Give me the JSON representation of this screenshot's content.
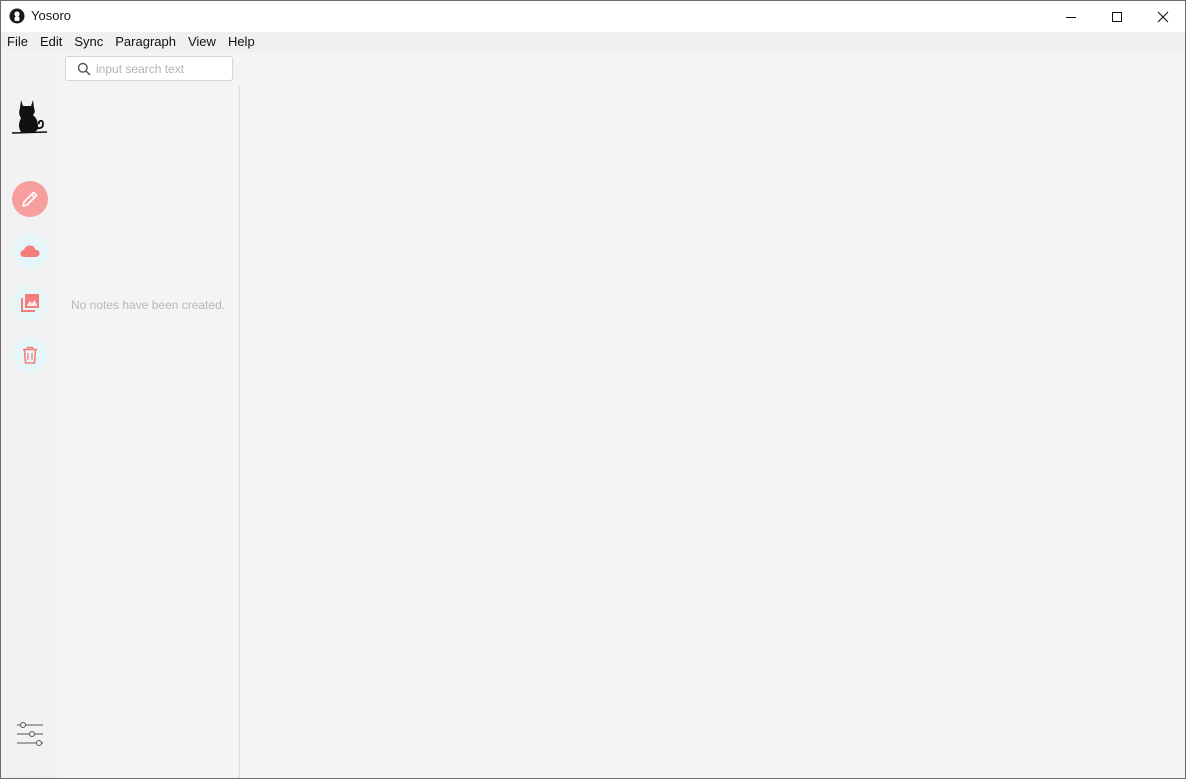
{
  "window": {
    "title": "Yosoro",
    "controls": [
      "minimize-icon",
      "maximize-icon",
      "close-icon"
    ]
  },
  "menu": {
    "items": [
      "File",
      "Edit",
      "Sync",
      "Paragraph",
      "View",
      "Help"
    ]
  },
  "search": {
    "placeholder": "input search text",
    "value": ""
  },
  "notes_list": {
    "empty_message": "No notes have been created."
  },
  "sidebar": {
    "buttons": [
      {
        "icon": "pencil-icon",
        "active": true
      },
      {
        "icon": "cloud-icon",
        "active": false
      },
      {
        "icon": "images-icon",
        "active": false
      },
      {
        "icon": "trash-icon",
        "active": false
      }
    ],
    "settings_icon": "sliders-icon"
  },
  "colors": {
    "accent": "#f79e9e",
    "accent_icon": "#f47e7e",
    "inactive_bg": "#e6f5f7",
    "background": "#f4f4f4"
  }
}
